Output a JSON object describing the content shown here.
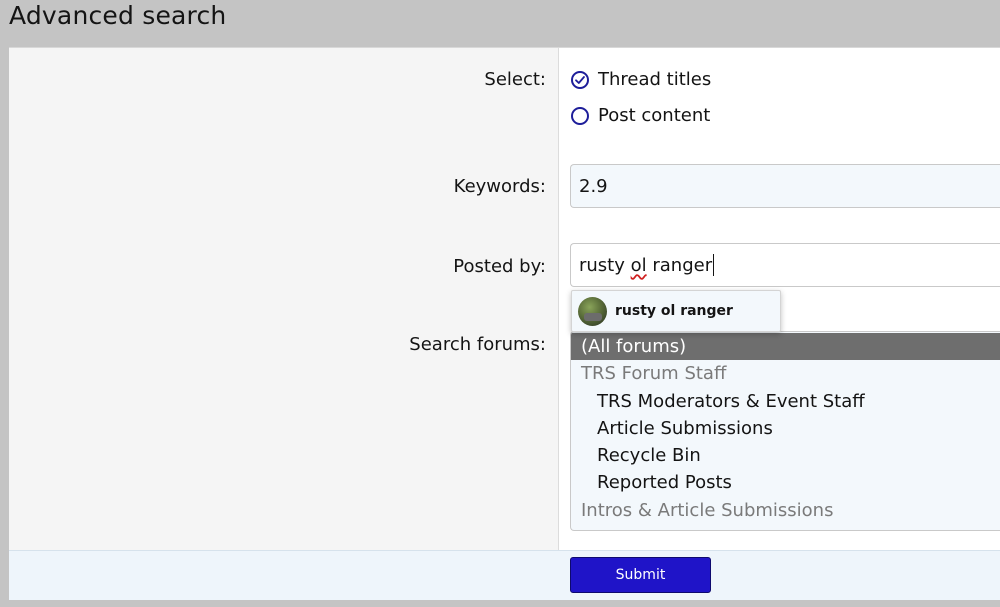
{
  "page": {
    "title": "Advanced search"
  },
  "select": {
    "label": "Select:",
    "options": [
      {
        "label": "Thread titles",
        "checked": true
      },
      {
        "label": "Post content",
        "checked": false
      }
    ]
  },
  "keywords": {
    "label": "Keywords:",
    "value": "2.9"
  },
  "posted_by": {
    "label": "Posted by:",
    "value_prefix": "rusty ",
    "value_misspelled": "ol",
    "value_suffix": " ranger",
    "suggestion": {
      "name": "rusty ol ranger",
      "avatar_icon": "user-avatar"
    }
  },
  "forums": {
    "label": "Search forums:",
    "options": [
      {
        "label": "(All forums)",
        "kind": "selected"
      },
      {
        "label": "TRS Forum Staff",
        "kind": "group"
      },
      {
        "label": "TRS Moderators & Event Staff",
        "kind": "child"
      },
      {
        "label": "Article Submissions",
        "kind": "child"
      },
      {
        "label": "Recycle Bin",
        "kind": "child"
      },
      {
        "label": "Reported Posts",
        "kind": "child"
      },
      {
        "label": "Intros & Article Submissions",
        "kind": "group"
      }
    ]
  },
  "submit": {
    "label": "Submit"
  },
  "colors": {
    "accent": "#1f14c8",
    "radio": "#1e1e9a",
    "selected_option_bg": "#6e6e6e"
  }
}
